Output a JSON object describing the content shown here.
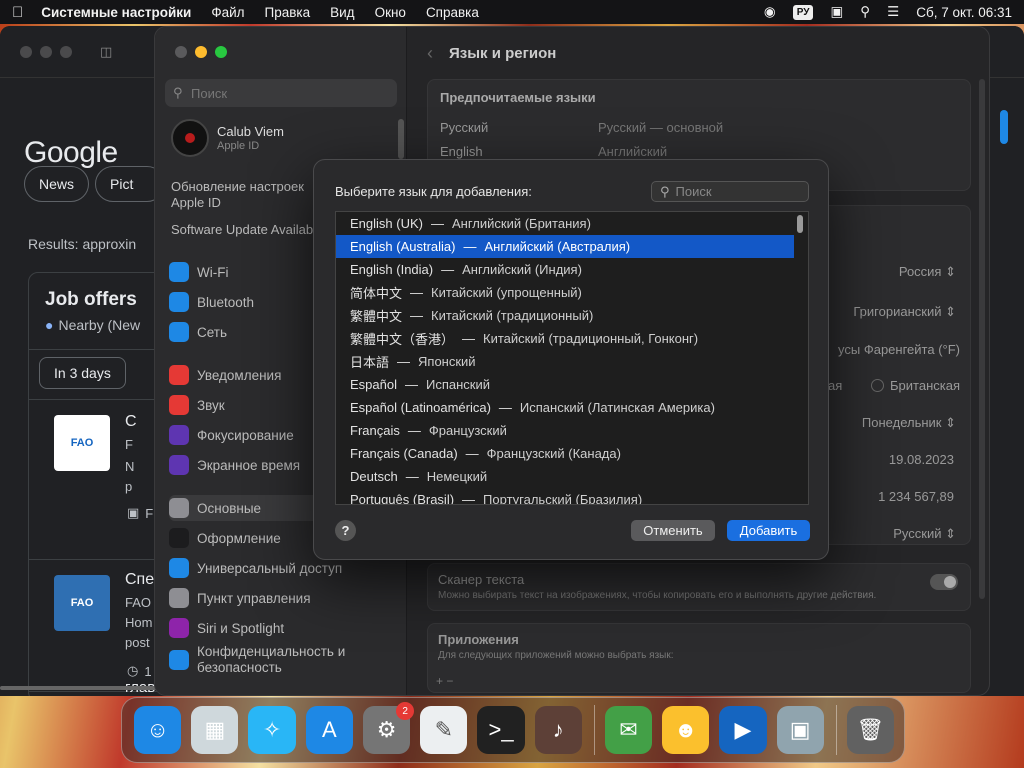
{
  "menubar": {
    "app_name": "Системные настройки",
    "items": [
      "Файл",
      "Правка",
      "Вид",
      "Окно",
      "Справка"
    ],
    "input_lang": "РУ",
    "datetime": "Сб, 7 окт.  06:31"
  },
  "browser": {
    "logo": "Google",
    "chips": [
      "News",
      "Pict"
    ],
    "results": "Results: approxin",
    "job_title": "Job offers",
    "job_sub": "Nearby (New",
    "job_filter": "In 3 days",
    "jobs": [
      {
        "title": "C",
        "line1": "F",
        "line2": "N",
        "line3": "p",
        "meta": "F"
      },
      {
        "title": "Спе",
        "line1": "FAO",
        "line2": "Hom",
        "line3": "post",
        "meta": "1"
      },
      {
        "title": "глав"
      }
    ],
    "logo_text": "FAO"
  },
  "settings": {
    "search_placeholder": "Поиск",
    "user_name": "Calub Viem",
    "user_sub": "Apple ID",
    "update_title": "Обновление настроек Apple ID",
    "update_sub": "Software Update Available",
    "items": [
      {
        "label": "Wi-Fi",
        "color": "#1e88e5"
      },
      {
        "label": "Bluetooth",
        "color": "#1e88e5"
      },
      {
        "label": "Сеть",
        "color": "#1e88e5"
      },
      {
        "label": "Уведомления",
        "color": "#e53935"
      },
      {
        "label": "Звук",
        "color": "#e53935"
      },
      {
        "label": "Фокусирование",
        "color": "#5e35b1"
      },
      {
        "label": "Экранное время",
        "color": "#5e35b1"
      },
      {
        "label": "Основные",
        "color": "#8e8e93"
      },
      {
        "label": "Оформление",
        "color": "#1c1c1e"
      },
      {
        "label": "Универсальный доступ",
        "color": "#1e88e5"
      },
      {
        "label": "Пункт управления",
        "color": "#8e8e93"
      },
      {
        "label": "Siri и Spotlight",
        "color": "#8e24aa"
      },
      {
        "label": "Конфиденциальность и безопасность",
        "color": "#1e88e5"
      }
    ],
    "page_title": "Язык и регион",
    "pref_langs_title": "Предпочитаемые языки",
    "pref_langs": [
      {
        "name": "Русский",
        "desc": "Русский — основной"
      },
      {
        "name": "English",
        "desc": "Английский"
      }
    ],
    "region_values": [
      "Россия",
      "Григорианский",
      "усы Фаренгейта (°F)",
      "Британская",
      "Понедельник",
      "19.08.2023",
      "1 234 567,89",
      "Русский"
    ],
    "region_radio_left": "кая",
    "live_text_title": "Сканер текста",
    "live_text_desc": "Можно выбирать текст на изображениях, чтобы копировать его и выполнять другие действия.",
    "apps_title": "Приложения",
    "apps_desc": "Для следующих приложений можно выбрать язык:",
    "apps_plus_minus": "+   −"
  },
  "dialog": {
    "title": "Выберите язык для добавления:",
    "search_placeholder": "Поиск",
    "languages": [
      {
        "name": "English (UK)",
        "tr": "Английский (Британия)"
      },
      {
        "name": "English (Australia)",
        "tr": "Английский (Австралия)",
        "selected": true
      },
      {
        "name": "English (India)",
        "tr": "Английский (Индия)"
      },
      {
        "name": "简体中文",
        "tr": "Китайский (упрощенный)"
      },
      {
        "name": "繁體中文",
        "tr": "Китайский (традиционный)"
      },
      {
        "name": "繁體中文（香港）",
        "tr": "Китайский (традиционный, Гонконг)"
      },
      {
        "name": "日本語",
        "tr": "Японский"
      },
      {
        "name": "Español",
        "tr": "Испанский"
      },
      {
        "name": "Español (Latinoamérica)",
        "tr": "Испанский (Латинская Америка)"
      },
      {
        "name": "Français",
        "tr": "Французский"
      },
      {
        "name": "Français (Canada)",
        "tr": "Французский (Канада)"
      },
      {
        "name": "Deutsch",
        "tr": "Немецкий"
      },
      {
        "name": "Português (Brasil)",
        "tr": "Португальский (Бразилия)"
      }
    ],
    "cancel": "Отменить",
    "add": "Добавить",
    "help": "?"
  },
  "dock": {
    "apps": [
      {
        "name": "finder-icon",
        "color": "#1e88e5",
        "glyph": "☺"
      },
      {
        "name": "launchpad-icon",
        "color": "#cfd8dc",
        "glyph": "▦"
      },
      {
        "name": "safari-icon",
        "color": "#29b6f6",
        "glyph": "✧"
      },
      {
        "name": "app-store-icon",
        "color": "#1e88e5",
        "glyph": "A"
      },
      {
        "name": "system-settings-icon",
        "color": "#757575",
        "glyph": "⚙",
        "badge": "2"
      },
      {
        "name": "textedit-icon",
        "color": "#eceff1",
        "glyph": "✎"
      },
      {
        "name": "terminal-icon",
        "color": "#212121",
        "glyph": ">_"
      },
      {
        "name": "garageband-icon",
        "color": "#5d4037",
        "glyph": "♪"
      },
      {
        "name": "messages-icon",
        "color": "#43a047",
        "glyph": "✉"
      },
      {
        "name": "ichat-icon",
        "color": "#fbc02d",
        "glyph": "☻"
      },
      {
        "name": "imovie-icon",
        "color": "#1565c0",
        "glyph": "▶"
      },
      {
        "name": "preview-icon",
        "color": "#90a4ae",
        "glyph": "▣"
      },
      {
        "name": "trash-icon",
        "color": "#616161",
        "glyph": "🗑"
      }
    ]
  }
}
